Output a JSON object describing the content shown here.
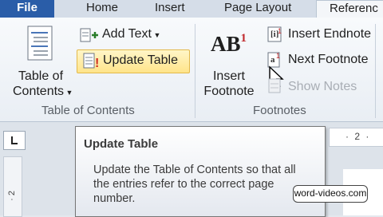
{
  "tabs": [
    "File",
    "Home",
    "Insert",
    "Page Layout",
    "Referenc"
  ],
  "toc_group": {
    "toc_button_line1": "Table of",
    "toc_button_line2": "Contents",
    "add_text": "Add Text",
    "update_table": "Update Table",
    "label": "Table of Contents"
  },
  "footnotes_group": {
    "insert_footnote_line1": "Insert",
    "insert_footnote_line2": "Footnote",
    "insert_endnote": "Insert Endnote",
    "next_footnote": "Next Footnote",
    "show_notes": "Show Notes",
    "label": "Footnotes"
  },
  "ab_glyph": "AB",
  "ab_superscript": "1",
  "ruler": {
    "top_marks": "· 2 ·",
    "left_marks": "· 2"
  },
  "tooltip": {
    "title": "Update Table",
    "body": "Update the Table of Contents so that all the entries refer to the correct page number."
  },
  "watermark": "word-videos.com",
  "colors": {
    "file_tab": "#2a5da8",
    "highlight": "#ffe48a",
    "footnote_red": "#c0282c"
  }
}
